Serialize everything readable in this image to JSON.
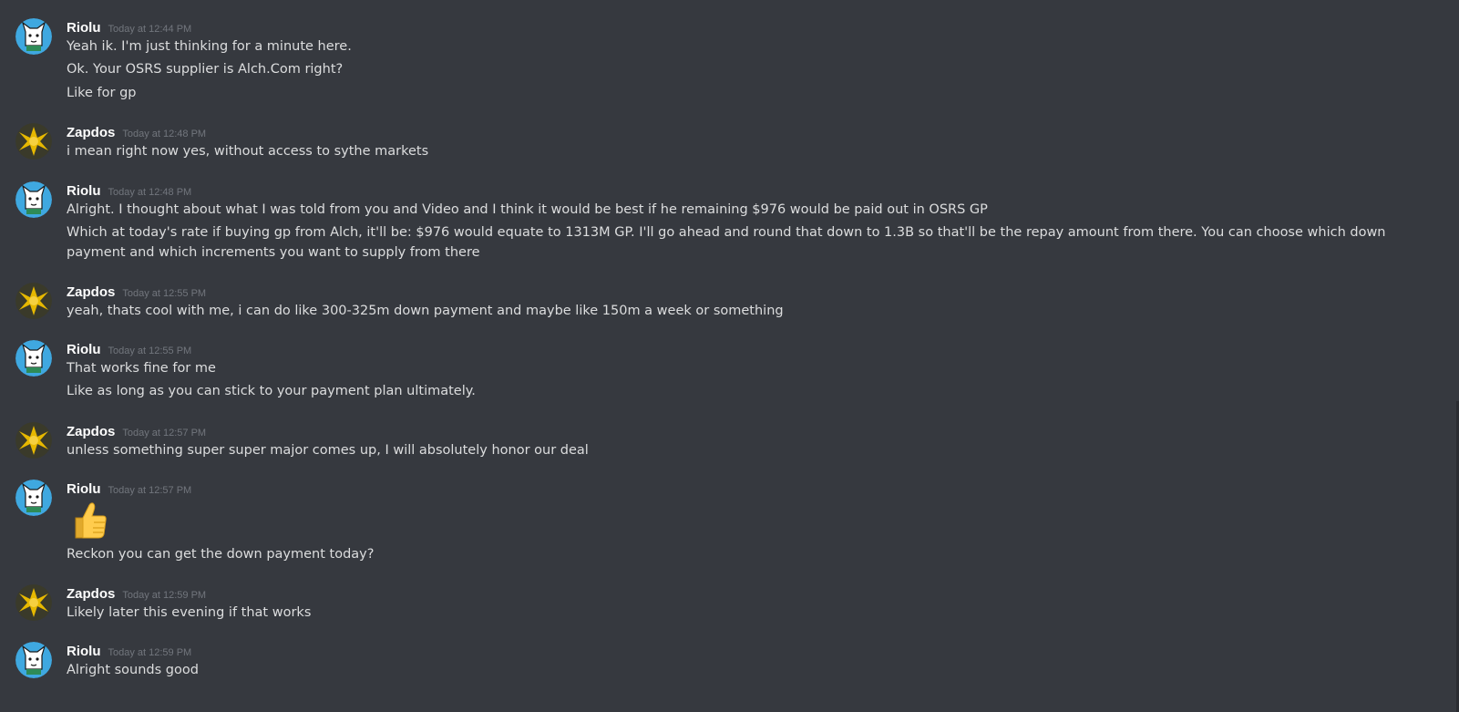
{
  "messages": [
    {
      "author": "Riolu",
      "timestamp": "Today at 12:44 PM",
      "avatar": "riolu-avatar",
      "lines": [
        "Yeah ik. I'm just thinking for a minute here.",
        "Ok. Your OSRS supplier is Alch.Com right?",
        "Like for gp"
      ]
    },
    {
      "author": "Zapdos",
      "timestamp": "Today at 12:48 PM",
      "avatar": "zapdos-avatar",
      "lines": [
        "i mean right now yes, without access to sythe markets"
      ]
    },
    {
      "author": "Riolu",
      "timestamp": "Today at 12:48 PM",
      "avatar": "riolu-avatar",
      "lines": [
        "Alright. I thought about what I was told from you and Video and I think it would be best if he remaining $976 would be paid out in OSRS GP",
        "Which at today's rate if buying gp from Alch, it'll be: $976 would equate to 1313M GP. I'll go ahead and round that down to 1.3B so that'll be the repay amount from there. You can choose which down payment and which increments you want to supply from there"
      ]
    },
    {
      "author": "Zapdos",
      "timestamp": "Today at 12:55 PM",
      "avatar": "zapdos-avatar",
      "lines": [
        "yeah, thats cool with me, i can do like 300-325m down payment and maybe like 150m a week or something"
      ]
    },
    {
      "author": "Riolu",
      "timestamp": "Today at 12:55 PM",
      "avatar": "riolu-avatar",
      "lines": [
        "That works fine for me",
        "Like as long as you can stick to your payment plan ultimately."
      ]
    },
    {
      "author": "Zapdos",
      "timestamp": "Today at 12:57 PM",
      "avatar": "zapdos-avatar",
      "lines": [
        "unless something super super major comes up, I will absolutely honor our deal"
      ]
    },
    {
      "author": "Riolu",
      "timestamp": "Today at 12:57 PM",
      "avatar": "riolu-avatar",
      "emoji": "thumbs-up-emoji",
      "lines": [
        "Reckon you can get the down payment today?"
      ]
    },
    {
      "author": "Zapdos",
      "timestamp": "Today at 12:59 PM",
      "avatar": "zapdos-avatar",
      "lines": [
        "Likely later this evening if that works"
      ]
    },
    {
      "author": "Riolu",
      "timestamp": "Today at 12:59 PM",
      "avatar": "riolu-avatar",
      "lines": [
        "Alright sounds good"
      ]
    }
  ],
  "colors": {
    "background": "#36393f",
    "username": "#ffffff",
    "timestamp": "#72767d",
    "text": "#dcddde",
    "riolu_avatar_bg": "#3fa8e0",
    "zapdos_avatar_bg": "#e6b800"
  }
}
